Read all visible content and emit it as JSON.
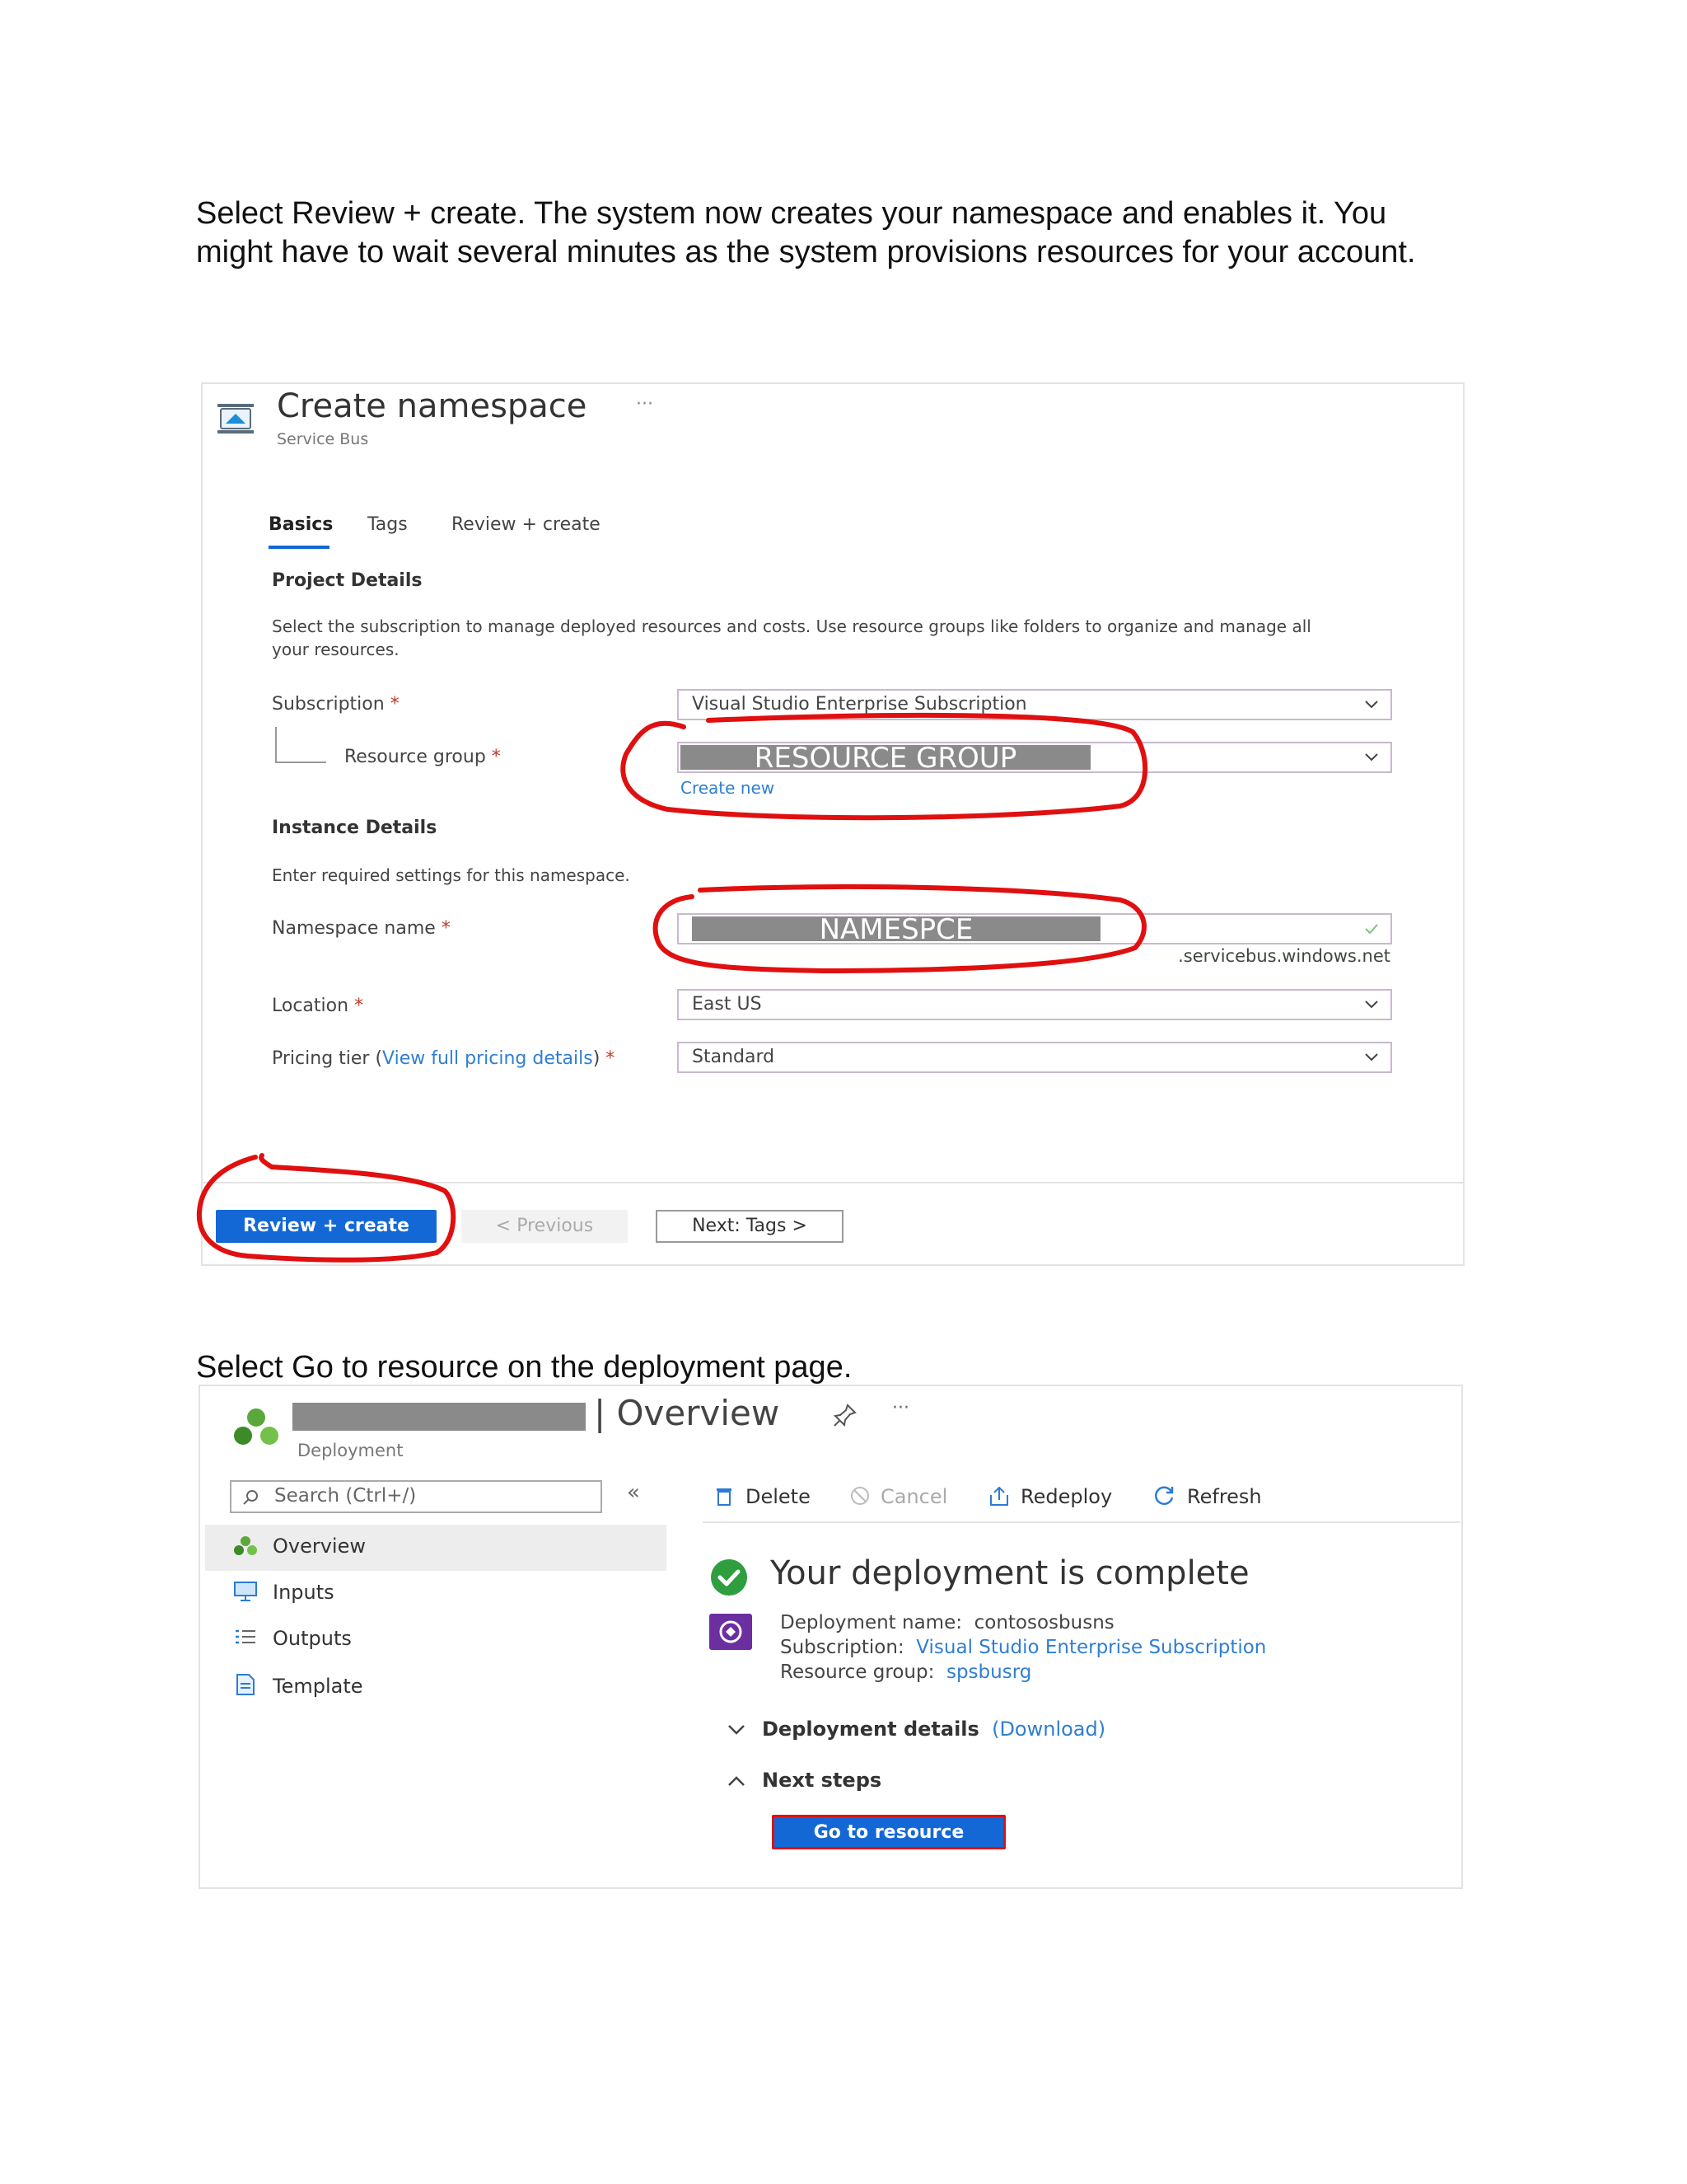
{
  "instructions": {
    "step1": "Select Review + create. The system now creates your namespace and enables it. You might have to wait several minutes as the system provisions resources for your account.",
    "step2": "Select Go to resource on the deployment page."
  },
  "create_namespace": {
    "title": "Create namespace",
    "subtitle": "Service Bus",
    "ellipsis": "···",
    "tabs": [
      "Basics",
      "Tags",
      "Review + create"
    ],
    "project_details": {
      "heading": "Project Details",
      "description": "Select the subscription to manage deployed resources and costs. Use resource groups like folders to organize and manage all your resources.",
      "subscription_label": "Subscription",
      "subscription_value": "Visual Studio Enterprise Subscription",
      "resource_group_label": "Resource group",
      "resource_group_value": "RESOURCE GROUP",
      "create_new": "Create new"
    },
    "instance_details": {
      "heading": "Instance Details",
      "description": "Enter required settings for this namespace.",
      "namespace_label": "Namespace name",
      "namespace_value": "NAMESPCE",
      "namespace_suffix": ".servicebus.windows.net",
      "location_label": "Location",
      "location_value": "East US",
      "pricing_label": "Pricing tier (",
      "pricing_link": "View full pricing details",
      "pricing_close": ")",
      "pricing_value": "Standard"
    },
    "required_marker": "*",
    "buttons": {
      "review_create": "Review + create",
      "previous": "< Previous",
      "next": "Next: Tags >"
    },
    "annotation_color": "#e01010"
  },
  "deployment": {
    "title": "| Overview",
    "subtitle": "Deployment",
    "search_placeholder": "Search (Ctrl+/)",
    "collapse": "«",
    "toolbar": {
      "delete": "Delete",
      "cancel": "Cancel",
      "redeploy": "Redeploy",
      "refresh": "Refresh"
    },
    "nav": [
      "Overview",
      "Inputs",
      "Outputs",
      "Template"
    ],
    "status": "Your deployment is complete",
    "details": {
      "name_label": "Deployment name:",
      "name_value": "contososbusns",
      "subscription_label": "Subscription:",
      "subscription_value": "Visual Studio Enterprise Subscription",
      "rg_label": "Resource group:",
      "rg_value": "spsbusrg"
    },
    "deployment_details": "Deployment details",
    "download": "(Download)",
    "next_steps": "Next steps",
    "go_to_resource": "Go to resource",
    "success_color": "#2e9e3e"
  }
}
